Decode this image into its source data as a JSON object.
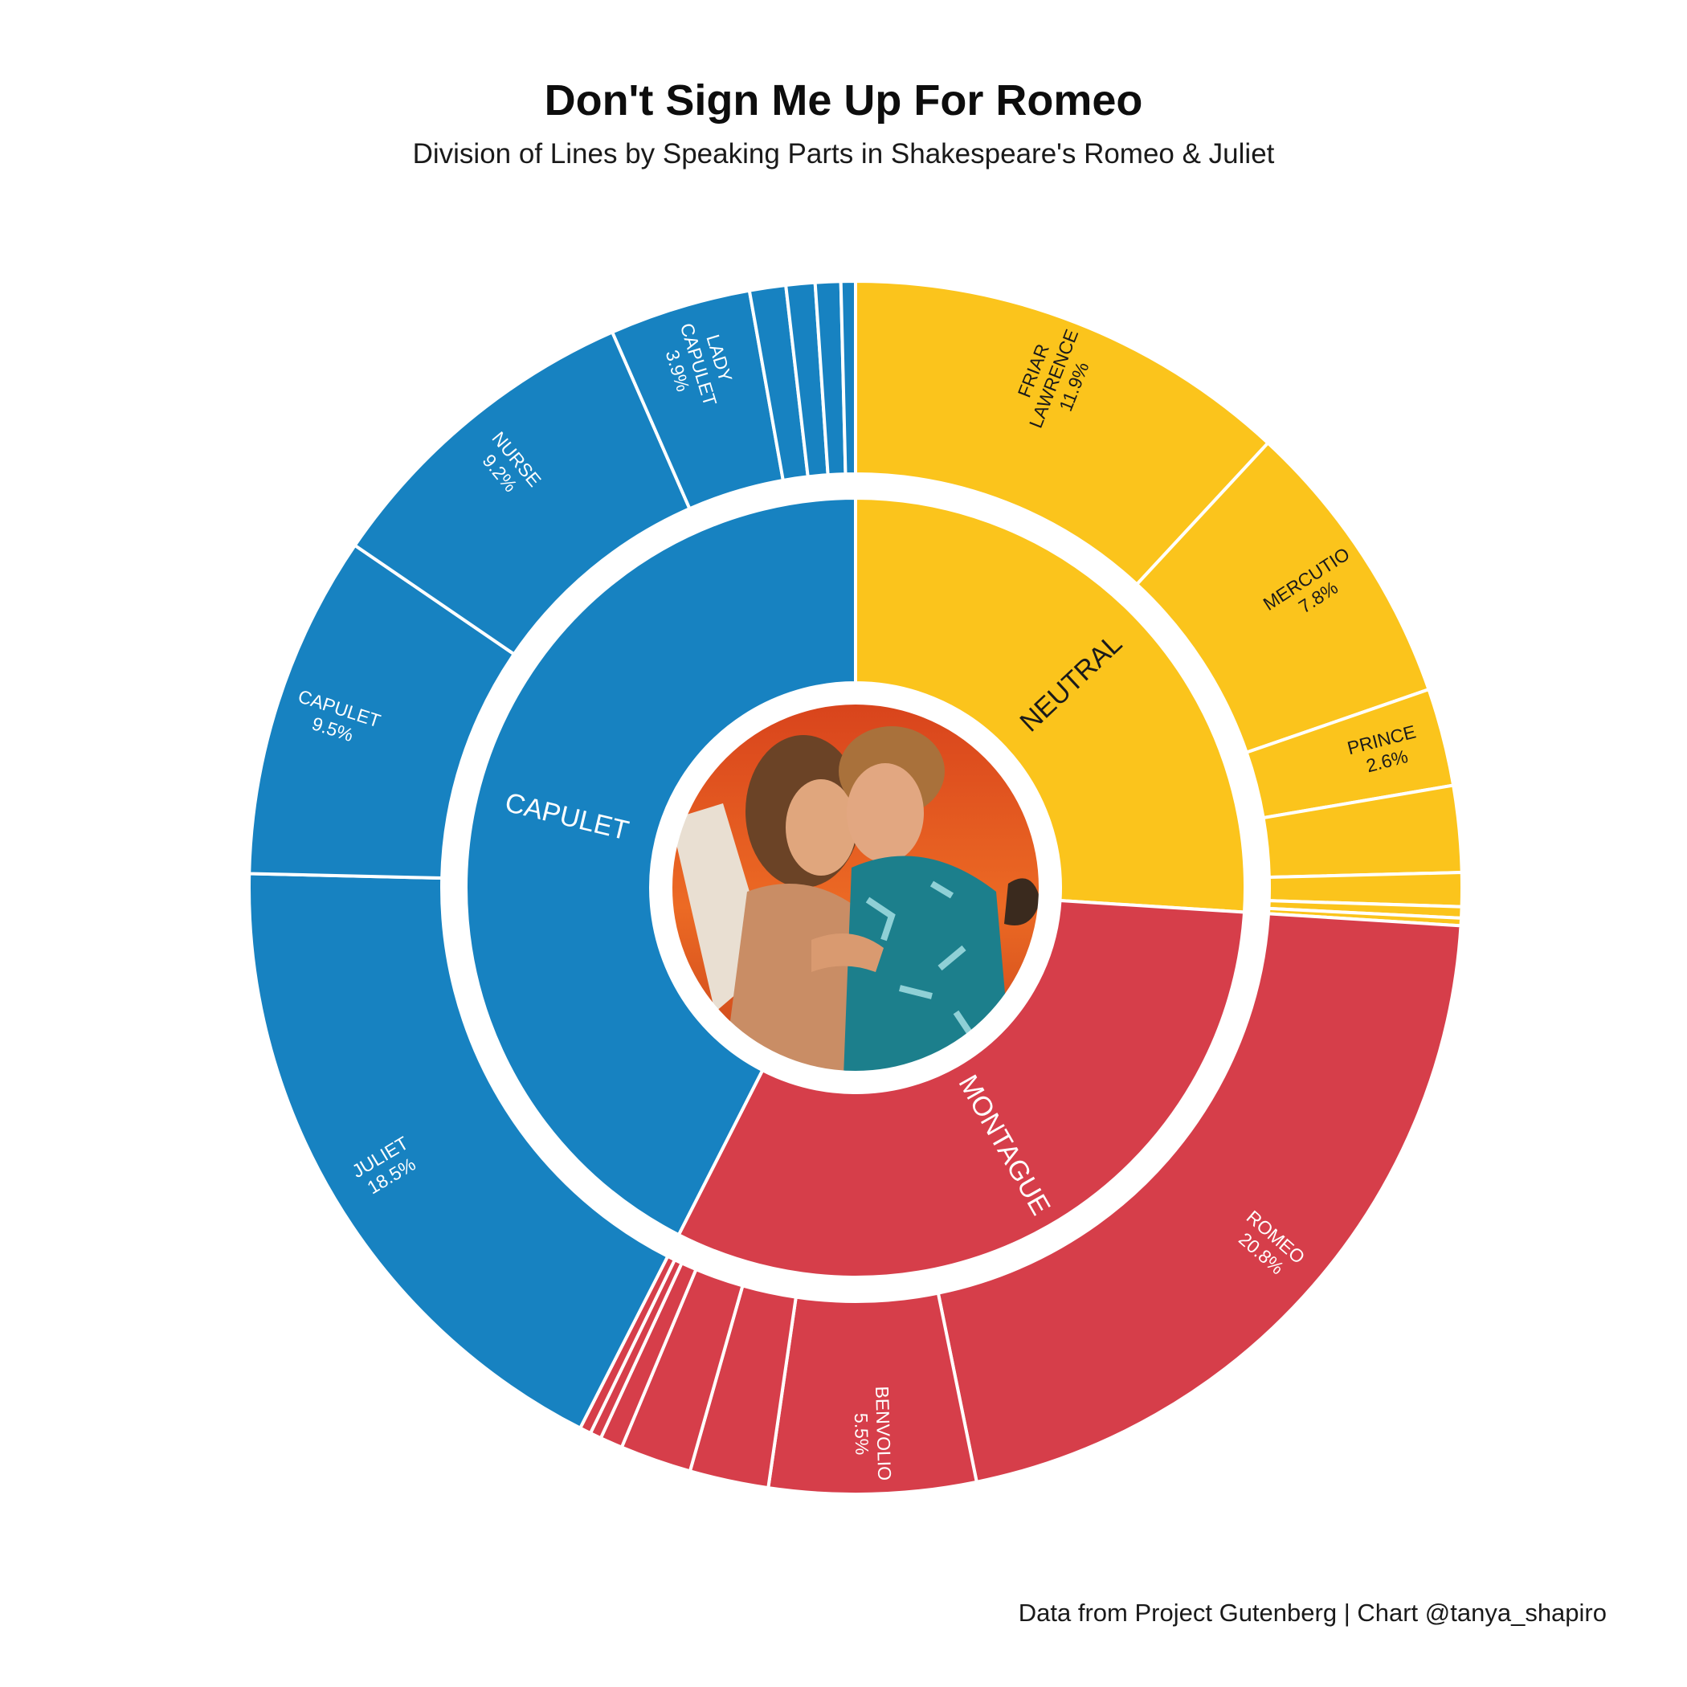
{
  "title": "Don't Sign Me Up For Romeo",
  "subtitle": "Division of Lines by Speaking Parts in Shakespeare's Romeo & Juliet",
  "caption": "Data from Project Gutenberg | Chart @tanya_shapiro",
  "colors": {
    "NEUTRAL": "#FBC41C",
    "MONTAGUE": "#D63E4A",
    "CAPULET": "#1782C1",
    "label_dark": "#1a1a1a",
    "label_light": "#ffffff"
  },
  "center_image": "photo of Romeo and Juliet kissing against an orange sunset sky",
  "chart_data": {
    "type": "sunburst",
    "title": "Don't Sign Me Up For Romeo",
    "subtitle": "Division of Lines by Speaking Parts in Shakespeare's Romeo & Juliet",
    "unit": "share of lines (%)",
    "groups": [
      {
        "name": "NEUTRAL",
        "value": 26.0,
        "parts": [
          {
            "name": "FRIAR LAWRENCE",
            "value": 11.9,
            "label": "FRIAR\nLAWRENCE\n11.9%"
          },
          {
            "name": "MERCUTIO",
            "value": 7.8,
            "label": "MERCUTIO\n7.8%"
          },
          {
            "name": "PRINCE",
            "value": 2.6,
            "label": "PRINCE\n2.6%"
          },
          {
            "name": "",
            "value": 2.3
          },
          {
            "name": "",
            "value": 0.9
          },
          {
            "name": "",
            "value": 0.3
          },
          {
            "name": "",
            "value": 0.2
          }
        ]
      },
      {
        "name": "MONTAGUE",
        "value": 31.5,
        "parts": [
          {
            "name": "ROMEO",
            "value": 20.8,
            "label": "ROMEO\n20.8%"
          },
          {
            "name": "BENVOLIO",
            "value": 5.5,
            "label": "BENVOLIO\n5.5%"
          },
          {
            "name": "",
            "value": 2.1
          },
          {
            "name": "",
            "value": 1.9
          },
          {
            "name": "",
            "value": 0.6
          },
          {
            "name": "",
            "value": 0.3
          },
          {
            "name": "",
            "value": 0.3
          }
        ]
      },
      {
        "name": "CAPULET",
        "value": 42.5,
        "parts": [
          {
            "name": "JULIET",
            "value": 18.5,
            "label": "JULIET\n18.5%"
          },
          {
            "name": "CAPULET",
            "value": 9.5,
            "label": "CAPULET\n9.5%"
          },
          {
            "name": "NURSE",
            "value": 9.2,
            "label": "NURSE\n9.2%"
          },
          {
            "name": "LADY CAPULET",
            "value": 3.9,
            "label": "LADY\nCAPULET\n3.9%"
          },
          {
            "name": "",
            "value": 1.0
          },
          {
            "name": "",
            "value": 0.8
          },
          {
            "name": "",
            "value": 0.7
          },
          {
            "name": "",
            "value": 0.4
          }
        ]
      }
    ]
  }
}
